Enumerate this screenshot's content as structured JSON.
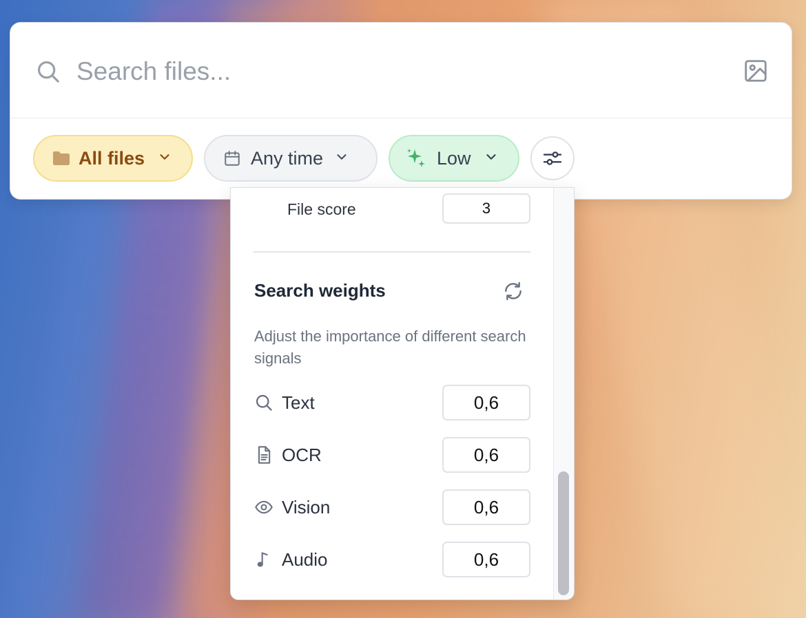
{
  "search": {
    "placeholder": "Search files...",
    "icon": "search-icon",
    "image_button_icon": "image-icon"
  },
  "filters": {
    "files": {
      "label": "All files",
      "icon": "folder-icon",
      "color": "#fcefc2"
    },
    "time": {
      "label": "Any time",
      "icon": "calendar-icon"
    },
    "quality": {
      "label": "Low",
      "icon": "sparkles-icon",
      "color": "#dcf6e4"
    },
    "settings_icon": "sliders-icon"
  },
  "panel": {
    "file_score": {
      "label": "File score",
      "value": "3"
    },
    "weights": {
      "title": "Search weights",
      "reset_icon": "refresh-icon",
      "description": "Adjust the importance of different search signals",
      "items": [
        {
          "label": "Text",
          "icon": "search-icon",
          "value": "0,6"
        },
        {
          "label": "OCR",
          "icon": "document-icon",
          "value": "0,6"
        },
        {
          "label": "Vision",
          "icon": "eye-icon",
          "value": "0,6"
        },
        {
          "label": "Audio",
          "icon": "music-note-icon",
          "value": "0,6"
        }
      ]
    }
  }
}
